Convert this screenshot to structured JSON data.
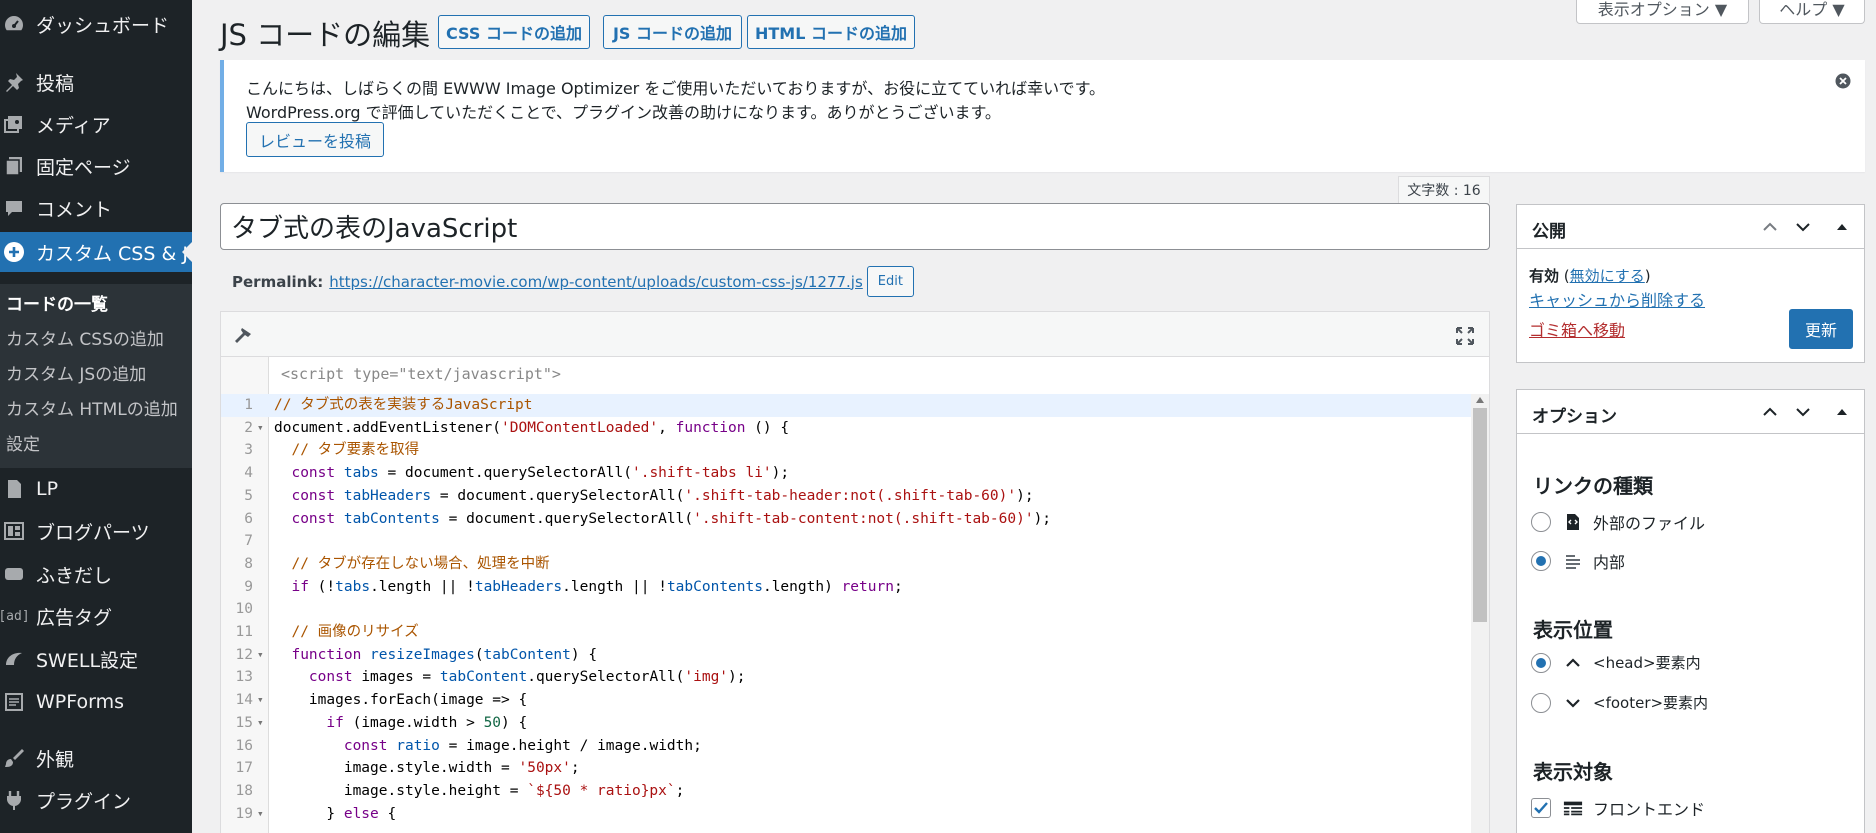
{
  "sidebar": {
    "items": [
      {
        "label": "ダッシュボード",
        "icon": "dashboard-icon"
      },
      {
        "label": "投稿",
        "icon": "pin-icon"
      },
      {
        "label": "メディア",
        "icon": "media-icon"
      },
      {
        "label": "固定ページ",
        "icon": "page-icon"
      },
      {
        "label": "コメント",
        "icon": "comment-icon"
      },
      {
        "label": "カスタム CSS & JS",
        "icon": "plus-circle-icon"
      },
      {
        "label": "LP",
        "icon": "document-icon"
      },
      {
        "label": "ブログパーツ",
        "icon": "layout-icon"
      },
      {
        "label": "ふきだし",
        "icon": "speech-bubble-icon"
      },
      {
        "label": "広告タグ",
        "icon": "ad-icon",
        "icon_text": "[ad]"
      },
      {
        "label": "SWELL設定",
        "icon": "swell-icon"
      },
      {
        "label": "WPForms",
        "icon": "form-icon"
      },
      {
        "label": "外観",
        "icon": "brush-icon"
      },
      {
        "label": "プラグイン",
        "icon": "plugin-icon"
      }
    ],
    "submenu": [
      "コードの一覧",
      "カスタム CSSの追加",
      "カスタム JSの追加",
      "カスタム HTMLの追加",
      "設定"
    ]
  },
  "header": {
    "title": "JS コードの編集",
    "buttons": [
      "CSS コードの追加",
      "JS コードの追加",
      "HTML コードの追加"
    ],
    "screen_options": "表示オプション ▼",
    "help": "ヘルプ ▼"
  },
  "notice": {
    "line1": "こんにちは、しばらくの間 EWWW Image Optimizer をご使用いただいておりますが、お役に立てていれば幸いです。",
    "line2": "WordPress.org で評価していただくことで、プラグイン改善の助けになります。ありがとうございます。",
    "review_button": "レビューを投稿"
  },
  "editor": {
    "char_count": "文字数 : 16",
    "title": "タブ式の表のJavaScript",
    "permalink_label": "Permalink:",
    "permalink_url": "https://character-movie.com/wp-content/uploads/custom-css-js/1277.js",
    "edit_button": "Edit",
    "script_open": "<script type=\"text/javascript\">"
  },
  "code_lines": [
    {
      "n": "1",
      "fold": "",
      "text": "// タブ式の表を実装するJavaScript"
    },
    {
      "n": "2",
      "fold": "▾",
      "text": "document.addEventListener('DOMContentLoaded', function () {"
    },
    {
      "n": "3",
      "fold": "",
      "text": "  // タブ要素を取得"
    },
    {
      "n": "4",
      "fold": "",
      "text": "  const tabs = document.querySelectorAll('.shift-tabs li');"
    },
    {
      "n": "5",
      "fold": "",
      "text": "  const tabHeaders = document.querySelectorAll('.shift-tab-header:not(.shift-tab-60)');"
    },
    {
      "n": "6",
      "fold": "",
      "text": "  const tabContents = document.querySelectorAll('.shift-tab-content:not(.shift-tab-60)');"
    },
    {
      "n": "7",
      "fold": "",
      "text": ""
    },
    {
      "n": "8",
      "fold": "",
      "text": "  // タブが存在しない場合、処理を中断"
    },
    {
      "n": "9",
      "fold": "",
      "text": "  if (!tabs.length || !tabHeaders.length || !tabContents.length) return;"
    },
    {
      "n": "10",
      "fold": "",
      "text": ""
    },
    {
      "n": "11",
      "fold": "",
      "text": "  // 画像のリサイズ"
    },
    {
      "n": "12",
      "fold": "▾",
      "text": "  function resizeImages(tabContent) {"
    },
    {
      "n": "13",
      "fold": "",
      "text": "    const images = tabContent.querySelectorAll('img');"
    },
    {
      "n": "14",
      "fold": "▾",
      "text": "    images.forEach(image => {"
    },
    {
      "n": "15",
      "fold": "▾",
      "text": "      if (image.width > 50) {"
    },
    {
      "n": "16",
      "fold": "",
      "text": "        const ratio = image.height / image.width;"
    },
    {
      "n": "17",
      "fold": "",
      "text": "        image.style.width = '50px';"
    },
    {
      "n": "18",
      "fold": "",
      "text": "        image.style.height = `${50 * ratio}px`;"
    },
    {
      "n": "19",
      "fold": "▾",
      "text": "      } else {"
    }
  ],
  "publish": {
    "title": "公開",
    "status_label": "有効",
    "status_link": "無効にする",
    "clear_cache": "キャッシュから削除する",
    "trash": "ゴミ箱へ移動",
    "update_button": "更新"
  },
  "options": {
    "title": "オプション",
    "link_type_heading": "リンクの種類",
    "link_type": [
      {
        "label": "外部のファイル",
        "selected": false
      },
      {
        "label": "内部",
        "selected": true
      }
    ],
    "position_heading": "表示位置",
    "position": [
      {
        "label": "<head>要素内",
        "selected": true
      },
      {
        "label": "<footer>要素内",
        "selected": false
      }
    ],
    "target_heading": "表示対象",
    "target": [
      {
        "label": "フロントエンド",
        "checked": true
      }
    ]
  },
  "colors": {
    "sidebar_bg": "#1d2327",
    "accent": "#2271b1",
    "notice_border": "#72aee6",
    "trash": "#b32d2e"
  }
}
